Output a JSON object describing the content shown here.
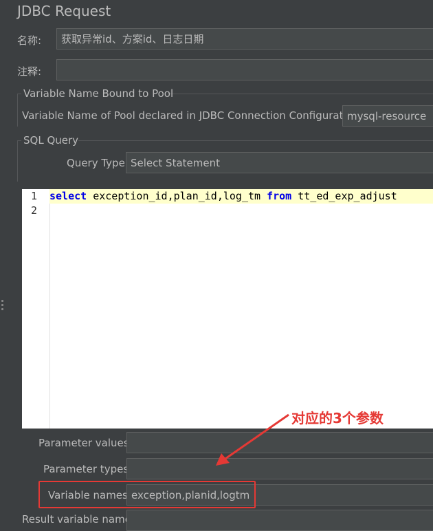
{
  "title": "JDBC Request",
  "name_label": "名称:",
  "name_value": "获取异常id、方案id、日志日期",
  "comments_label": "注释:",
  "comments_value": "",
  "pool_group_title": "Variable Name Bound to Pool",
  "pool_label": "Variable Name of Pool declared in JDBC Connection Configuration:",
  "pool_value": "mysql-resource",
  "sql_group_title": "SQL Query",
  "query_type_label": "Query Type:",
  "query_type_value": "Select Statement",
  "editor": {
    "line_numbers": [
      "1",
      "2"
    ],
    "kw_select": "select",
    "cols": " exception_id,plan_id,log_tm ",
    "kw_from": "from",
    "table": " tt_ed_exp_adjust"
  },
  "parameter_values_label": "Parameter values:",
  "parameter_values_value": "",
  "parameter_types_label": "Parameter types:",
  "parameter_types_value": "",
  "variable_names_label": "Variable names:",
  "variable_names_value": "exception,planid,logtm",
  "result_variable_label": "Result variable name:",
  "annotation_text": "对应的3个参数",
  "colors": {
    "background": "#3c3f41",
    "field": "#45494a",
    "keyword": "#0000e6",
    "annotation": "#e53935"
  }
}
